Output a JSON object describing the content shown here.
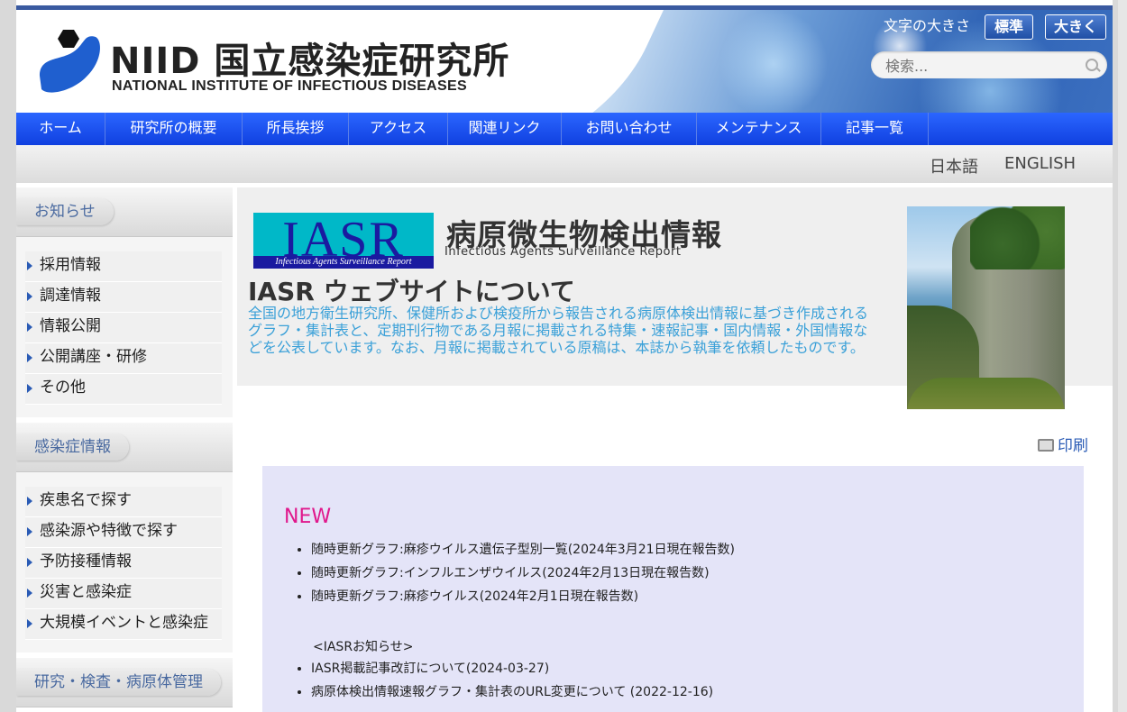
{
  "header": {
    "logo_jp": "NIID 国立感染症研究所",
    "logo_en": "NATIONAL INSTITUTE OF INFECTIOUS DISEASES",
    "fontsize_label": "文字の大きさ",
    "fontsize_standard": "標準",
    "fontsize_large": "大きく",
    "search_placeholder": "検索..."
  },
  "nav": {
    "items": [
      {
        "label": "ホーム"
      },
      {
        "label": "研究所の概要"
      },
      {
        "label": "所長挨拶"
      },
      {
        "label": "アクセス"
      },
      {
        "label": "関連リンク"
      },
      {
        "label": "お問い合わせ"
      },
      {
        "label": "メンテナンス"
      },
      {
        "label": "記事一覧"
      }
    ]
  },
  "lang": {
    "japanese": "日本語",
    "english": "ENGLISH"
  },
  "sidebar": {
    "section1": {
      "title": "お知らせ",
      "items": [
        {
          "label": "採用情報"
        },
        {
          "label": "調達情報"
        },
        {
          "label": "情報公開"
        },
        {
          "label": "公開講座・研修"
        },
        {
          "label": "その他"
        }
      ]
    },
    "section2": {
      "title": "感染症情報",
      "items": [
        {
          "label": "疾患名で探す"
        },
        {
          "label": "感染源や特徴で探す"
        },
        {
          "label": "予防接種情報"
        },
        {
          "label": "災害と感染症"
        },
        {
          "label": "大規模イベントと感染症"
        }
      ]
    },
    "section3": {
      "title": "研究・検査・病原体管理"
    }
  },
  "hero": {
    "logo_big": "IASR",
    "logo_small": "Infectious Agents Surveillance Report",
    "title": "病原微生物検出情報",
    "subtitle": "Infectious Agents Surveillance Report",
    "heading": "IASR ウェブサイトについて",
    "description": "全国の地方衛生研究所、保健所および検疫所から報告される病原体検出情報に基づき作成されるグラフ・集計表と、定期刊行物である月報に掲載される特集・速報記事・国内情報・外国情報などを公表しています。なお、月報に掲載されている原稿は、本誌から執筆を依頼したものです。"
  },
  "print_label": "印刷",
  "news": {
    "new_label": "NEW",
    "items": [
      {
        "link": "随時更新グラフ:麻疹ウイルス遺伝子型別一覧",
        "date": "(2024年3月21日現在報告数)"
      },
      {
        "link": "随時更新グラフ:インフルエンザウイルス",
        "date": "(2024年2月13日現在報告数)"
      },
      {
        "link": "随時更新グラフ:麻疹ウイルス",
        "date": "(2024年2月1日現在報告数)"
      }
    ],
    "notice_title": "<IASRお知らせ>",
    "notices": [
      {
        "link": "IASR掲載記事改訂について",
        "date": "(2024-03-27)"
      },
      {
        "link": "病原体検出情報速報グラフ・集計表のURL変更について",
        "date": " (2022-12-16)"
      }
    ]
  },
  "colors": {
    "nav": "#1f4fe8",
    "accent": "#2a5bb5",
    "new": "#e0188c",
    "desc": "#3aa0d8"
  }
}
